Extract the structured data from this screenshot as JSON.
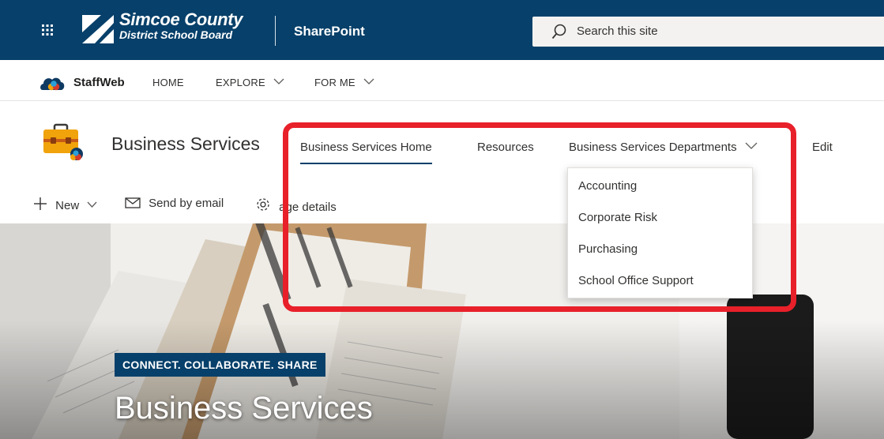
{
  "suite_bar": {
    "logo_line1": "Simcoe County",
    "logo_line2": "District School Board",
    "app_label": "SharePoint",
    "search_placeholder": "Search this site",
    "background_color": "#07406a"
  },
  "hub_nav": {
    "title": "StaffWeb",
    "links": [
      "HOME",
      "EXPLORE",
      "FOR ME"
    ]
  },
  "site_header": {
    "site_title": "Business Services",
    "nav": {
      "home": "Business Services Home",
      "resources": "Resources",
      "departments": "Business Services Departments",
      "edit": "Edit"
    },
    "accent_color": "#07406a"
  },
  "departments_menu": {
    "items": [
      "Accounting",
      "Corporate Risk",
      "Purchasing",
      "School Office Support"
    ]
  },
  "command_bar": {
    "new_label": "New",
    "send_label": "Send by email",
    "page_details_label": "age details"
  },
  "hero": {
    "tagline": "CONNECT. COLLABORATE. SHARE",
    "title": "Business Services"
  },
  "annotation": {
    "highlight_color": "#e8202a"
  }
}
